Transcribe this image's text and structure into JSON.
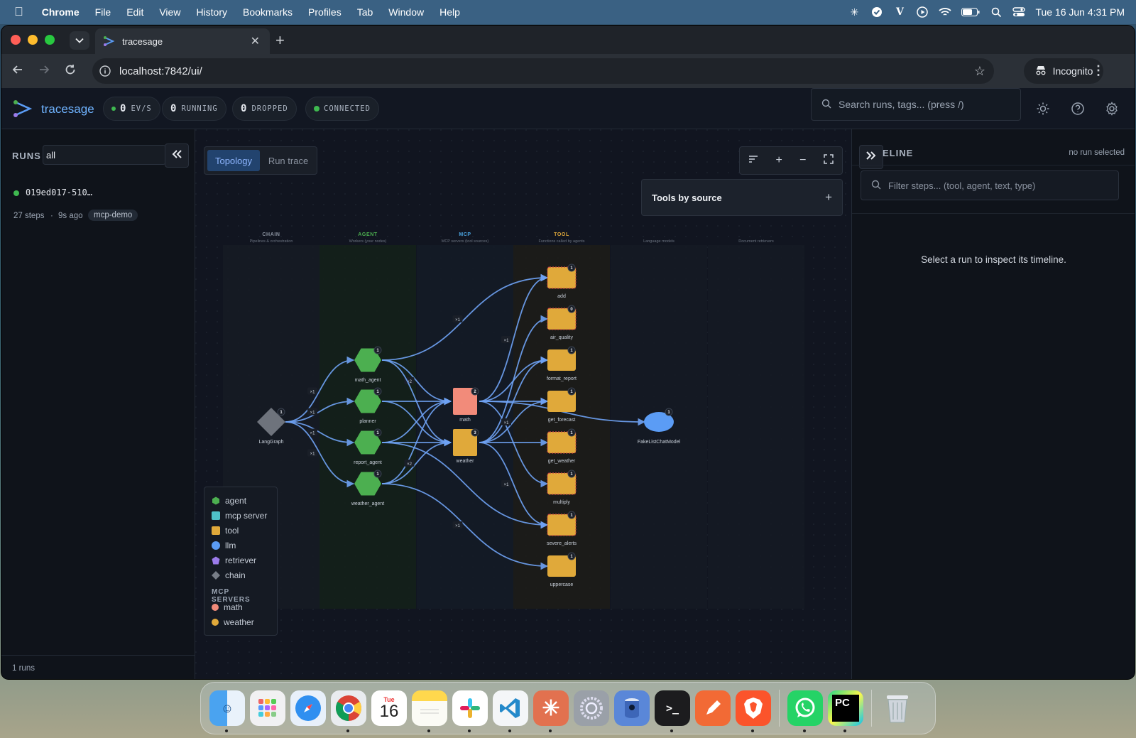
{
  "menubar": {
    "app": "Chrome",
    "items": [
      "File",
      "Edit",
      "View",
      "History",
      "Bookmarks",
      "Profiles",
      "Tab",
      "Window",
      "Help"
    ],
    "datetime": "Tue 16 Jun  4:31 PM"
  },
  "browser": {
    "tab_title": "tracesage",
    "url": "localhost:7842/ui/",
    "incognito_label": "Incognito"
  },
  "header": {
    "brand": "tracesage",
    "ev_count": "0",
    "ev_label": "EV/S",
    "running_count": "0",
    "running_label": "RUNNING",
    "dropped_count": "0",
    "dropped_label": "DROPPED",
    "connected_label": "CONNECTED",
    "search_placeholder": "Search runs, tags... (press /)"
  },
  "sidebar": {
    "runs_label": "RUNS",
    "filter_value": "all",
    "runs": [
      {
        "id": "019ed017-510…",
        "steps": "27 steps",
        "age": "9s ago",
        "tag": "mcp-demo"
      }
    ],
    "footer": "1 runs"
  },
  "center": {
    "tabs": [
      "Topology",
      "Run trace"
    ],
    "tools_panel_title": "Tools by source",
    "columns": [
      {
        "title": "CHAIN",
        "sub": "Pipelines & orchestration",
        "color": "#8b93a0"
      },
      {
        "title": "AGENT",
        "sub": "Workers (your nodes)",
        "color": "#4caf50"
      },
      {
        "title": "MCP",
        "sub": "MCP servers (tool sources)",
        "color": "#4aa3df"
      },
      {
        "title": "TOOL",
        "sub": "Functions called by agents",
        "color": "#e0a93a"
      },
      {
        "title": "",
        "sub": "Language models",
        "color": "#5b6270"
      },
      {
        "title": "",
        "sub": "Document retrievers",
        "color": "#5b6270"
      }
    ],
    "chain_nodes": [
      {
        "label": "LangGraph",
        "count": "1"
      }
    ],
    "agent_nodes": [
      {
        "label": "math_agent",
        "count": "1"
      },
      {
        "label": "planner",
        "count": "1"
      },
      {
        "label": "report_agent",
        "count": "1"
      },
      {
        "label": "weather_agent",
        "count": "1"
      }
    ],
    "mcp_nodes": [
      {
        "label": "math",
        "count": "2",
        "color": "#f28b7a"
      },
      {
        "label": "weather",
        "count": "3",
        "color": "#e0a93a"
      }
    ],
    "tool_nodes": [
      {
        "label": "add",
        "count": "1"
      },
      {
        "label": "air_quality",
        "count": "0"
      },
      {
        "label": "format_report",
        "count": "1"
      },
      {
        "label": "get_forecast",
        "count": "1"
      },
      {
        "label": "get_weather",
        "count": "1"
      },
      {
        "label": "multiply",
        "count": "1"
      },
      {
        "label": "severe_alerts",
        "count": "1"
      },
      {
        "label": "uppercase",
        "count": "1"
      }
    ],
    "llm_nodes": [
      {
        "label": "FakeListChatModel",
        "count": "1"
      }
    ],
    "edge_label": "×1",
    "edge_label_2": "×2",
    "legend": {
      "types": [
        {
          "label": "agent",
          "color": "#4caf50",
          "shape": "hexagon-icon"
        },
        {
          "label": "mcp server",
          "color": "#4fc1c9",
          "shape": "square-icon"
        },
        {
          "label": "tool",
          "color": "#e0a93a",
          "shape": "square-icon"
        },
        {
          "label": "llm",
          "color": "#5b9cf5",
          "shape": "circle-icon"
        },
        {
          "label": "retriever",
          "color": "#9b7bea",
          "shape": "pentagon-icon"
        },
        {
          "label": "chain",
          "color": "#777d87",
          "shape": "diamond-icon"
        }
      ],
      "servers_heading": "MCP SERVERS",
      "servers": [
        {
          "label": "math",
          "color": "#f28b7a"
        },
        {
          "label": "weather",
          "color": "#e0a93a"
        }
      ]
    }
  },
  "timeline": {
    "title": "ELINE",
    "status": "no run selected",
    "filter_placeholder": "Filter steps... (tool, agent, text, type)",
    "empty": "Select a run to inspect its timeline."
  },
  "dock": {
    "calendar_month": "Tue",
    "calendar_day": "16",
    "pycharm": "PC"
  }
}
